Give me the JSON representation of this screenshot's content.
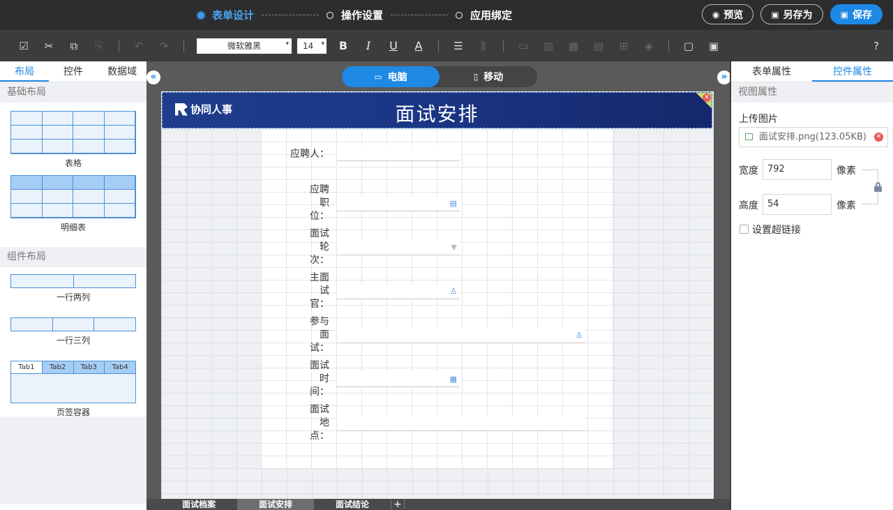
{
  "steps": [
    {
      "label": "表单设计",
      "active": true
    },
    {
      "label": "操作设置",
      "active": false
    },
    {
      "label": "应用绑定",
      "active": false
    }
  ],
  "top_actions": {
    "preview": "预览",
    "save_as": "另存为",
    "save": "保存"
  },
  "toolbar": {
    "font": "微软雅黑",
    "size": "14",
    "bold": "B",
    "italic": "I",
    "underline": "U",
    "font_color": "A"
  },
  "left_panel": {
    "tabs": [
      "布局",
      "控件",
      "数据域"
    ],
    "section_basic": "基础布局",
    "table_label": "表格",
    "detail_label": "明细表",
    "section_component": "组件布局",
    "row_two_label": "一行两列",
    "row_three_label": "一行三列",
    "tab_container_label": "页签容器",
    "tab_names": [
      "Tab1",
      "Tab2",
      "Tab3",
      "Tab4"
    ]
  },
  "canvas": {
    "device_pc": "电脑",
    "device_mobile": "移动",
    "logo_text": "协同人事",
    "banner_title": "面试安排",
    "fields": [
      {
        "label": "应聘人：",
        "icon": ""
      },
      {
        "label": "应聘职位：",
        "icon": "id-card"
      },
      {
        "label": "面试轮次：",
        "icon": "dropdown"
      },
      {
        "label": "主面试官：",
        "icon": "person"
      },
      {
        "label": "参与面试：",
        "icon": "people"
      },
      {
        "label": "面试时间：",
        "icon": "calendar"
      },
      {
        "label": "面试地点：",
        "icon": ""
      }
    ],
    "page_tabs": [
      {
        "label": "面试档案",
        "active": false
      },
      {
        "label": "面试安排",
        "active": true
      },
      {
        "label": "面试结论",
        "active": false
      }
    ],
    "add_tab": "+"
  },
  "right_panel": {
    "tabs": [
      "表单属性",
      "控件属性"
    ],
    "section": "视图属性",
    "upload_label": "上传图片",
    "file_name": "面试安排.png(123.05KB)",
    "width_label": "宽度",
    "width_value": "792",
    "height_label": "高度",
    "height_value": "54",
    "unit": "像素",
    "hyperlink_label": "设置超链接"
  },
  "colors": {
    "accent": "#1e88e5",
    "topbar": "#2d2d2d",
    "banner": "#1f3d8c"
  }
}
